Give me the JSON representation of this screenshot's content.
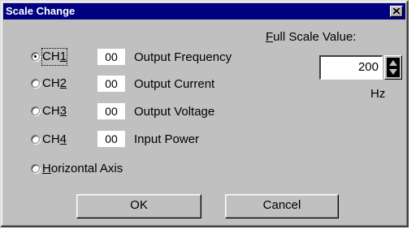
{
  "dialog": {
    "title": "Scale Change",
    "close_icon": "close-icon"
  },
  "channels": [
    {
      "label_prefix": "CH",
      "label_hotkey": "1",
      "selected": true,
      "code": "00",
      "description": "Output Frequency"
    },
    {
      "label_prefix": "CH",
      "label_hotkey": "2",
      "selected": false,
      "code": "00",
      "description": "Output Current"
    },
    {
      "label_prefix": "CH",
      "label_hotkey": "3",
      "selected": false,
      "code": "00",
      "description": "Output Voltage"
    },
    {
      "label_prefix": "CH",
      "label_hotkey": "4",
      "selected": false,
      "code": "00",
      "description": "Input Power"
    }
  ],
  "horizontal_axis": {
    "hotkey": "H",
    "rest": "orizontal Axis",
    "selected": false
  },
  "full_scale": {
    "label_hotkey": "F",
    "label_rest": "ull Scale Value:",
    "value": "200",
    "unit": "Hz",
    "spinner_icon": "spin-up-down-icon"
  },
  "buttons": {
    "ok": "OK",
    "cancel": "Cancel"
  }
}
